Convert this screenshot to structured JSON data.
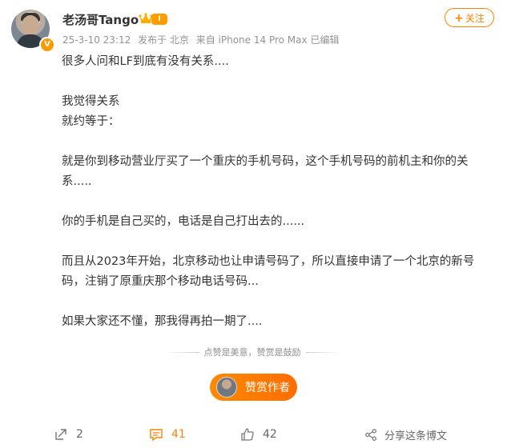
{
  "post": {
    "author": {
      "name": "老汤哥Tango",
      "level_badge": "I",
      "verified_badge": "V"
    },
    "meta": {
      "time": "25-3-10 23:12",
      "location": "发布于 北京",
      "source": "来自 iPhone 14 Pro Max",
      "edited": "已编辑"
    },
    "follow_label": "关注",
    "content": [
      "很多人问和LF到底有没有关系....",
      "",
      "我觉得关系",
      "就约等于：",
      "",
      "就是你到移动营业厅买了一个重庆的手机号码，这个手机号码的前机主和你的关系.....",
      "",
      "你的手机是自己买的，电话是自己打出去的......",
      "",
      "而且从2023年开始，北京移动也让申请号码了，所以直接申请了一个北京的新号码，注销了原重庆那个移动电话号码...",
      "",
      "如果大家还不懂，那我得再拍一期了...."
    ],
    "reward": {
      "divider_text": "点赞是美意，赞赏是鼓励",
      "button_label": "赞赏作者"
    },
    "footer": {
      "repost_count": "2",
      "comment_count": "41",
      "like_count": "42",
      "share_label": "分享这条博文"
    },
    "colors": {
      "accent": "#ff8200",
      "text": "#333333",
      "muted": "#939393"
    },
    "icons": [
      "verified-v-icon",
      "crown-icon",
      "repost-icon",
      "comment-icon",
      "like-icon",
      "share-icon"
    ]
  }
}
